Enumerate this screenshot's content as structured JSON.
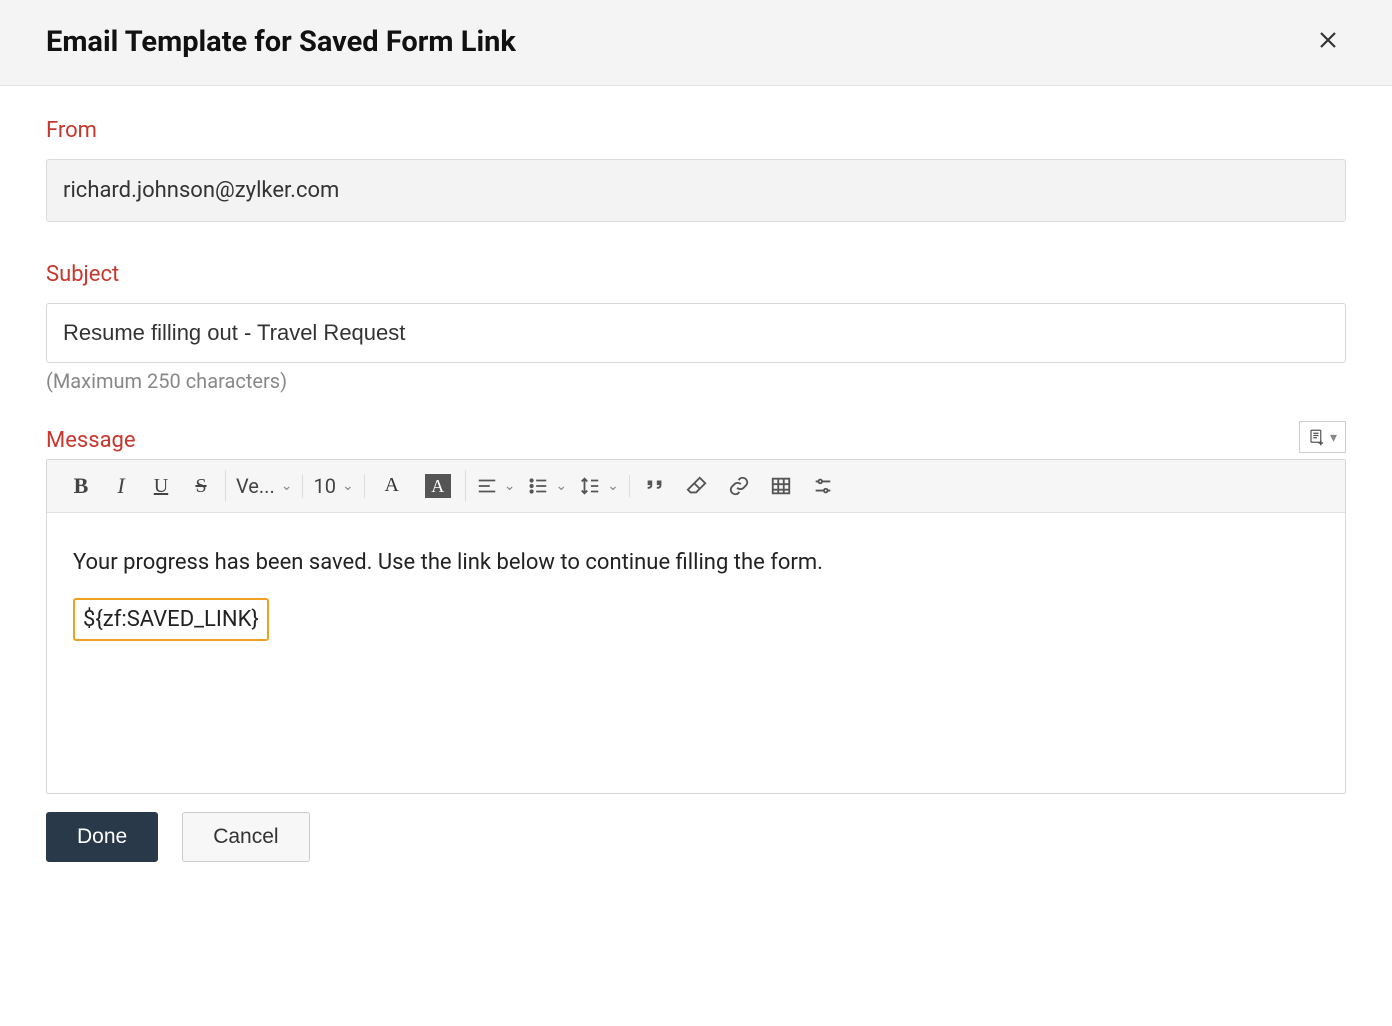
{
  "header": {
    "title": "Email Template for Saved Form Link"
  },
  "from": {
    "label": "From",
    "value": "richard.johnson@zylker.com"
  },
  "subject": {
    "label": "Subject",
    "value": "Resume filling out - Travel Request",
    "help": "(Maximum 250 characters)"
  },
  "message": {
    "label": "Message",
    "body_line1": "Your progress has been saved. Use the link below to continue filling the form.",
    "token": "${zf:SAVED_LINK}"
  },
  "toolbar": {
    "font_family": "Ve...",
    "font_size": "10"
  },
  "buttons": {
    "done": "Done",
    "cancel": "Cancel"
  }
}
